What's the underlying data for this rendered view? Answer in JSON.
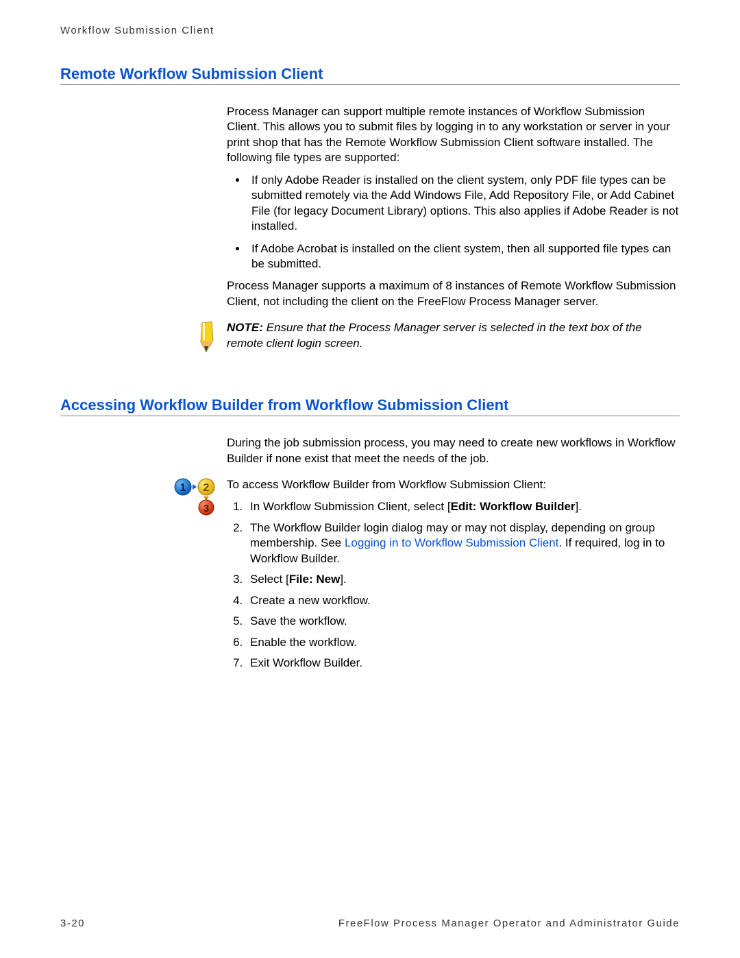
{
  "runningHeader": "Workflow Submission Client",
  "section1": {
    "heading": "Remote Workflow Submission Client",
    "p1": "Process Manager can support multiple remote instances of Workflow Submission Client. This allows you to submit files by logging in to any workstation or server in your print shop that has the Remote Workflow Submission Client software installed. The following file types are supported:",
    "b1": "If only Adobe Reader is installed on the client system, only PDF file types can be submitted remotely via the Add Windows File, Add Repository File, or Add Cabinet File (for legacy Document Library) options. This also applies if Adobe Reader is not installed.",
    "b2": "If Adobe Acrobat is installed on the client system, then all supported file types can be submitted.",
    "p2": "Process Manager supports a maximum of 8 instances of Remote Workflow Submission Client, not including the client on the FreeFlow Process Manager server.",
    "noteLabel": "NOTE: ",
    "noteText": " Ensure that the Process Manager server is selected in the text box of the remote client login screen."
  },
  "section2": {
    "heading": "Accessing Workflow Builder from Workflow Submission Client",
    "p1": "During the job submission process, you may need to create new workflows in Workflow Builder if none exist that meet the needs of the job.",
    "p2": "To access Workflow Builder from Workflow Submission Client:",
    "s1a": "In Workflow Submission Client, select [",
    "s1b": "Edit: Workflow Builder",
    "s1c": "].",
    "s2a": "The Workflow Builder login dialog may or may not display, depending on group membership. See ",
    "s2link": "Logging in to Workflow Submission Client",
    "s2b": ". If required, log in to Workflow Builder.",
    "s3a": "Select [",
    "s3b": "File: New",
    "s3c": "].",
    "s4": "Create a new workflow.",
    "s5": "Save the workflow.",
    "s6": "Enable the workflow.",
    "s7": "Exit Workflow Builder."
  },
  "footer": {
    "pageNum": "3-20",
    "guide": "FreeFlow Process Manager Operator and Administrator Guide"
  }
}
